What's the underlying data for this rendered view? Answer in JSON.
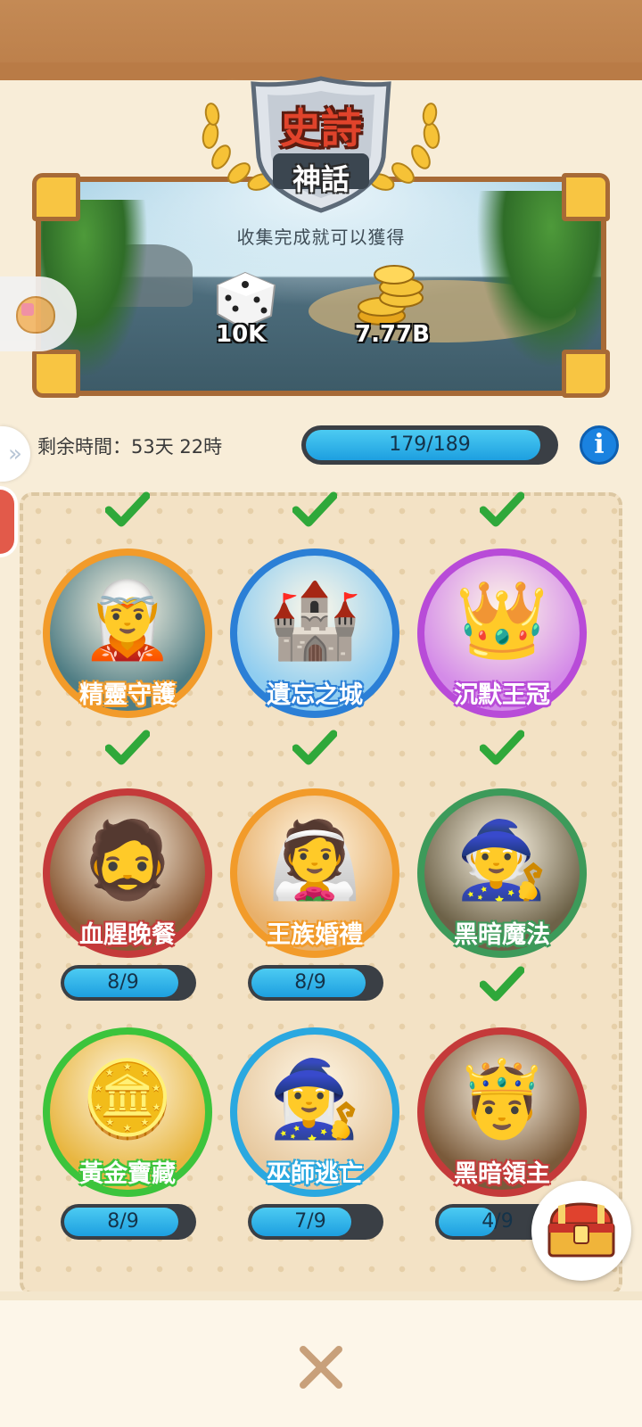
{
  "header": {
    "rarity_title": "史詩",
    "rarity_subtitle": "神話",
    "banner_text": "收集完成就可以獲得"
  },
  "rewards": [
    {
      "icon": "dice-icon",
      "value": "10K"
    },
    {
      "icon": "gold-coins-icon",
      "value": "7.77B"
    }
  ],
  "status": {
    "time_remaining": "剩余時間：53天 22時",
    "progress_label": "179/189",
    "progress_fraction": 0.947
  },
  "collections": [
    {
      "name": "精靈守護",
      "completed": true,
      "ring": "#f29b2a",
      "bg": "#4f7d84",
      "glyph": "🧝",
      "count": null,
      "fraction": null
    },
    {
      "name": "遺忘之城",
      "completed": true,
      "ring": "#2b7fd6",
      "bg": "#8fcdf0",
      "glyph": "🏰",
      "count": null,
      "fraction": null
    },
    {
      "name": "沉默王冠",
      "completed": true,
      "ring": "#b84bd8",
      "bg": "#d48be8",
      "glyph": "👑",
      "count": null,
      "fraction": null
    },
    {
      "name": "血腥晚餐",
      "completed": true,
      "ring": "#c43a3a",
      "bg": "#8a5a36",
      "glyph": "🧔",
      "count": "8/9",
      "fraction": 0.889
    },
    {
      "name": "王族婚禮",
      "completed": true,
      "ring": "#f29b2a",
      "bg": "#e8b06a",
      "glyph": "👰",
      "count": "8/9",
      "fraction": 0.889
    },
    {
      "name": "黑暗魔法",
      "completed": true,
      "ring": "#3d9a5a",
      "bg": "#6d6248",
      "glyph": "🧙",
      "count": null,
      "fraction": null
    },
    {
      "name": "黃金寶藏",
      "completed": false,
      "ring": "#3cc43c",
      "bg": "#e8b640",
      "glyph": "🪙",
      "count": "8/9",
      "fraction": 0.889
    },
    {
      "name": "巫師逃亡",
      "completed": false,
      "ring": "#2aa8e0",
      "bg": "#e7c9a0",
      "glyph": "🧙‍♀️",
      "count": "7/9",
      "fraction": 0.778
    },
    {
      "name": "黑暗領主",
      "completed": true,
      "ring": "#c43a3a",
      "bg": "#7a5a3a",
      "glyph": "🤴",
      "count": "4/9",
      "fraction": 0.444
    }
  ],
  "colors": {
    "accent_blue": "#1d9fe0",
    "frame_brown": "#a76a36",
    "check_green": "#2fa83a"
  },
  "icons": {
    "info": "info-icon",
    "close": "close-icon",
    "chest": "treasure-chest-icon",
    "check": "checkmark-icon"
  }
}
